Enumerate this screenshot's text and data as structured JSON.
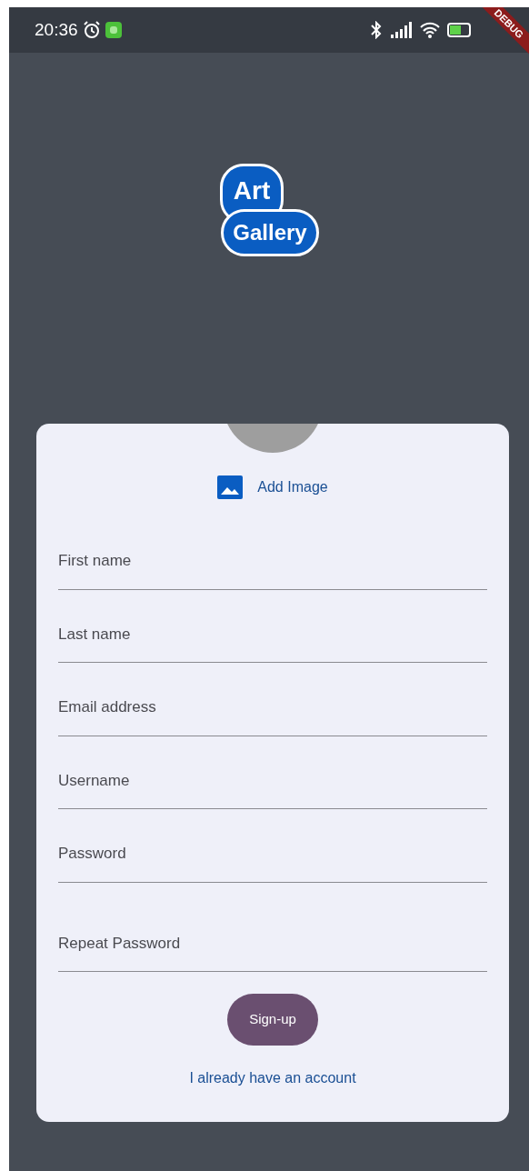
{
  "status_bar": {
    "time": "20:36"
  },
  "debug_banner": "DEBUG",
  "logo": {
    "line_1": "Art",
    "line_2": "Gallery"
  },
  "add_image": "Add Image",
  "fields": [
    {
      "placeholder": "First name"
    },
    {
      "placeholder": "Last name"
    },
    {
      "placeholder": "Email address"
    },
    {
      "placeholder": "Username"
    },
    {
      "placeholder": "Password"
    },
    {
      "placeholder": "Repeat Password"
    }
  ],
  "signup_button": "Sign-up",
  "login_link": "I already have an account"
}
